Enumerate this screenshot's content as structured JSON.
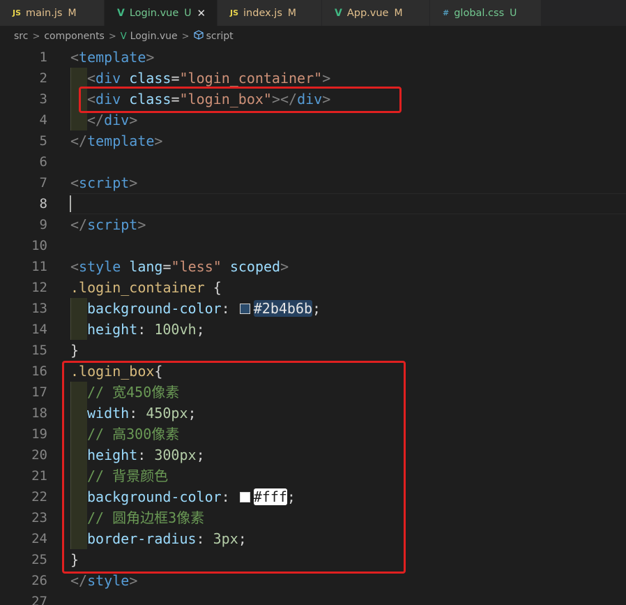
{
  "tabs": [
    {
      "icon": "JS",
      "icon_type": "js",
      "name": "main.js",
      "status": "M",
      "active": false
    },
    {
      "icon": "V",
      "icon_type": "vue",
      "name": "Login.vue",
      "status": "U",
      "active": true,
      "close": "✕"
    },
    {
      "icon": "JS",
      "icon_type": "js",
      "name": "index.js",
      "status": "M",
      "active": false
    },
    {
      "icon": "V",
      "icon_type": "vue",
      "name": "App.vue",
      "status": "M",
      "active": false
    },
    {
      "icon": "#",
      "icon_type": "css",
      "name": "global.css",
      "status": "U",
      "active": false
    }
  ],
  "breadcrumb": {
    "items": [
      "src",
      "components",
      "Login.vue",
      "script"
    ],
    "separator": ">"
  },
  "editor": {
    "current_line": 8,
    "lines": [
      {
        "n": "1"
      },
      {
        "n": "2"
      },
      {
        "n": "3"
      },
      {
        "n": "4"
      },
      {
        "n": "5"
      },
      {
        "n": "6"
      },
      {
        "n": "7"
      },
      {
        "n": "8"
      },
      {
        "n": "9"
      },
      {
        "n": "10"
      },
      {
        "n": "11"
      },
      {
        "n": "12"
      },
      {
        "n": "13"
      },
      {
        "n": "14"
      },
      {
        "n": "15"
      },
      {
        "n": "16"
      },
      {
        "n": "17"
      },
      {
        "n": "18"
      },
      {
        "n": "19"
      },
      {
        "n": "20"
      },
      {
        "n": "21"
      },
      {
        "n": "22"
      },
      {
        "n": "23"
      },
      {
        "n": "24"
      },
      {
        "n": "25"
      },
      {
        "n": "26"
      },
      {
        "n": "27"
      }
    ],
    "code": {
      "l1": {
        "lt": "<",
        "tag": "template",
        "gt": ">"
      },
      "l2": {
        "lt": "<",
        "tag": "div",
        "attr": "class",
        "eq": "=",
        "val": "\"login_container\"",
        "gt": ">"
      },
      "l3": {
        "lt": "<",
        "tag": "div",
        "attr": "class",
        "eq": "=",
        "val": "\"login_box\"",
        "gt": ">",
        "close_lt": "</",
        "close_tag": "div",
        "close_gt": ">"
      },
      "l4": {
        "lt": "</",
        "tag": "div",
        "gt": ">"
      },
      "l5": {
        "lt": "</",
        "tag": "template",
        "gt": ">"
      },
      "l7": {
        "lt": "<",
        "tag": "script",
        "gt": ">"
      },
      "l9": {
        "lt": "</",
        "tag": "script",
        "gt": ">"
      },
      "l11": {
        "lt": "<",
        "tag": "style",
        "attr1": "lang",
        "eq": "=",
        "val": "\"less\"",
        "attr2": "scoped",
        "gt": ">"
      },
      "l12": {
        "sel": ".login_container",
        "brace": "{"
      },
      "l13": {
        "prop": "background-color",
        "colon": ":",
        "value": "#2b4b6b",
        "semi": ";",
        "swatch": "#2b4b6b"
      },
      "l14": {
        "prop": "height",
        "colon": ":",
        "value": "100vh",
        "semi": ";"
      },
      "l15": {
        "brace": "}"
      },
      "l16": {
        "sel": ".login_box",
        "brace": "{"
      },
      "l17": {
        "comment": "// 宽450像素"
      },
      "l18": {
        "prop": "width",
        "colon": ":",
        "value": "450px",
        "semi": ";"
      },
      "l19": {
        "comment": "// 高300像素"
      },
      "l20": {
        "prop": "height",
        "colon": ":",
        "value": "300px",
        "semi": ";"
      },
      "l21": {
        "comment": "// 背景颜色"
      },
      "l22": {
        "prop": "background-color",
        "colon": ":",
        "value": "#fff",
        "semi": ";",
        "swatch": "#ffffff"
      },
      "l23": {
        "comment": "// 圆角边框3像素"
      },
      "l24": {
        "prop": "border-radius",
        "colon": ":",
        "value": "3px",
        "semi": ";"
      },
      "l25": {
        "brace": "}"
      },
      "l26": {
        "lt": "</",
        "tag": "style",
        "gt": ">"
      }
    }
  },
  "colors": {
    "editor_bg": "#1e1e1e",
    "annotation_red": "#e02020"
  }
}
